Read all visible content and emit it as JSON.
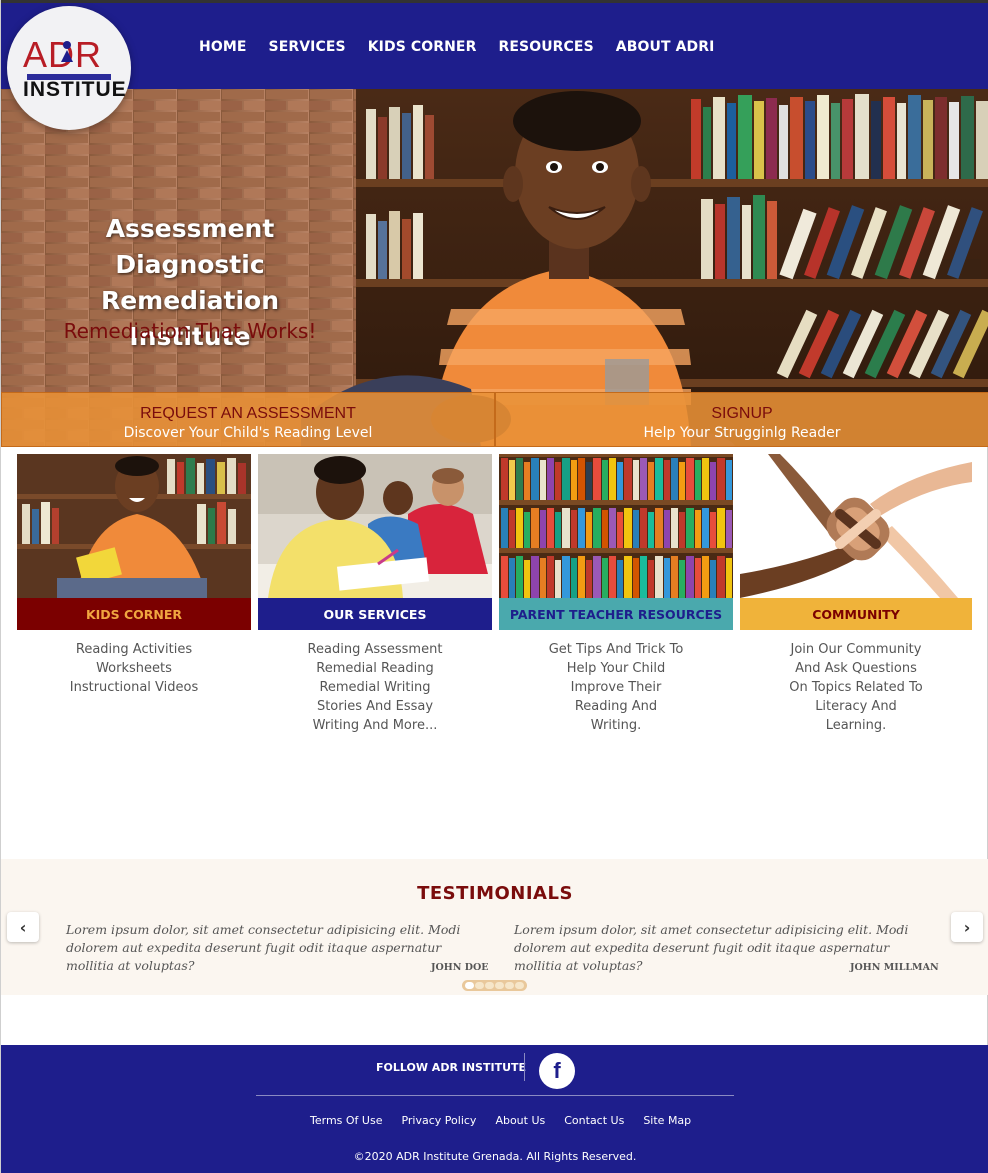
{
  "header": {
    "logo": {
      "line1": "ADR",
      "line2": "INSTITUE"
    },
    "nav": [
      "HOME",
      "SERVICES",
      "KIDS CORNER",
      "RESOURCES",
      "ABOUT ADRI"
    ]
  },
  "hero": {
    "title_lines": [
      "Assessment Diagnostic",
      "Remediation",
      "Institute"
    ],
    "tagline": "Remediation That Works!",
    "cta": [
      {
        "title": "REQUEST AN ASSESSMENT",
        "subtitle": "Discover Your Child's Reading Level"
      },
      {
        "title": "SIGNUP",
        "subtitle": "Help Your Strugginlg Reader"
      }
    ]
  },
  "cards": [
    {
      "title": "KIDS CORNER",
      "bar_color": "#7b0000",
      "text_color": "#f0a640",
      "lines": [
        "Reading Activities",
        "Worksheets",
        "Instructional Videos"
      ]
    },
    {
      "title": "OUR SERVICES",
      "bar_color": "#1e1e8c",
      "text_color": "#ffffff",
      "lines": [
        "Reading Assessment",
        "Remedial Reading",
        "Remedial Writing",
        "Stories And Essay",
        "Writing And More..."
      ]
    },
    {
      "title": "PARENT TEACHER RESOURCES",
      "bar_color": "#4aa9ad",
      "text_color": "#1e1e8c",
      "lines": [
        "Get Tips And Trick To",
        "Help Your Child",
        "Improve Their",
        "Reading And",
        "Writing."
      ]
    },
    {
      "title": "COMMUNITY",
      "bar_color": "#f0b33a",
      "text_color": "#7b0000",
      "lines": [
        "Join Our Community",
        "And Ask Questions",
        "On Topics Related To",
        "Literacy And",
        "Learning."
      ]
    }
  ],
  "testimonials": {
    "heading": "TESTIMONIALS",
    "items": [
      {
        "quote": "Lorem ipsum dolor, sit amet consectetur adipisicing elit. Modi dolorem aut expedita deserunt fugit odit itaque aspernatur mollitia at voluptas?",
        "author": "JOHN DOE"
      },
      {
        "quote": "Lorem ipsum dolor, sit amet consectetur adipisicing elit. Modi dolorem aut expedita deserunt fugit odit itaque aspernatur mollitia at voluptas?",
        "author": "JOHN MILLMAN"
      }
    ],
    "prev": "‹",
    "next": "›",
    "dot_count": 6,
    "active_dot": 1
  },
  "footer": {
    "follow": "FOLLOW ADR INSTITUTE",
    "social_icon": "facebook-icon",
    "social_glyph": "f",
    "links": [
      "Terms Of Use",
      "Privacy Policy",
      "About Us",
      "Contact Us",
      "Site Map"
    ],
    "copyright": "©2020 ADR Institute Grenada. All Rights Reserved."
  }
}
